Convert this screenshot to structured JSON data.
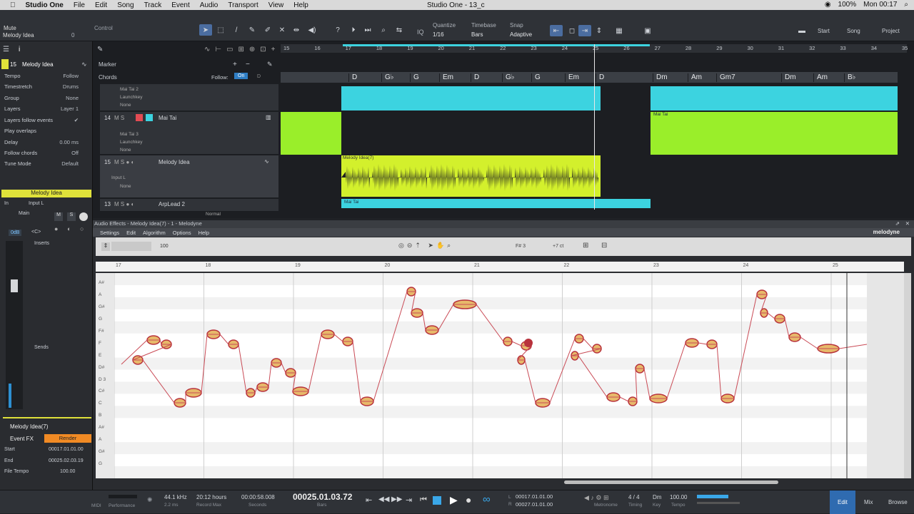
{
  "menubar": {
    "app": "Studio One",
    "items": [
      "File",
      "Edit",
      "Song",
      "Track",
      "Event",
      "Audio",
      "Transport",
      "View",
      "Help"
    ],
    "battery": "100%",
    "clock": "Mon 00:17"
  },
  "window": {
    "title": "Studio One - 13_c"
  },
  "toolbar": {
    "mute_label": "Mute",
    "track_name": "Melody Idea",
    "value": "0",
    "control": "Control",
    "quantize_label": "Quantize",
    "quantize_value": "1/16",
    "timebase_label": "Timebase",
    "timebase_value": "Bars",
    "snap_label": "Snap",
    "snap_value": "Adaptive",
    "start": "Start",
    "song": "Song",
    "project": "Project",
    "iq": "IQ"
  },
  "inspector": {
    "track_number": "15",
    "track_name": "Melody Idea",
    "rows": [
      {
        "k": "Tempo",
        "v": "Follow"
      },
      {
        "k": "Timestretch",
        "v": "Drums"
      },
      {
        "k": "Group",
        "v": "None"
      },
      {
        "k": "Layers",
        "v": "Layer 1"
      },
      {
        "k": "Layers follow events",
        "v": ""
      },
      {
        "k": "Play overlaps",
        "v": ""
      },
      {
        "k": "Delay",
        "v": "0.00 ms"
      },
      {
        "k": "Follow chords",
        "v": "Off"
      },
      {
        "k": "Tune Mode",
        "v": "Default"
      }
    ],
    "channel_name": "Melody Idea",
    "in_label": "In",
    "input": "Input L",
    "main": "Main",
    "db": "0dB",
    "pan": "<C>",
    "inserts": "Inserts",
    "sends": "Sends",
    "event_name": "Melody Idea(7)",
    "event_fx": "Event FX",
    "render": "Render",
    "start_label": "Start",
    "start": "00017.01.01.00",
    "end_label": "End",
    "end": "00025.02.03.19",
    "tempo_label": "File Tempo",
    "tempo": "100.00"
  },
  "arrange": {
    "marker": "Marker",
    "chords": "Chords",
    "follow": "Follow:",
    "on": "On",
    "ruler": [
      "15",
      "16",
      "17",
      "18",
      "19",
      "20",
      "21",
      "22",
      "23",
      "24",
      "25",
      "26",
      "27",
      "28",
      "29",
      "30",
      "31",
      "32",
      "33",
      "34",
      "35"
    ],
    "chordlist": [
      "D",
      "G♭",
      "G",
      "Em",
      "D",
      "G♭",
      "G",
      "Em",
      "D",
      "Dm",
      "Am",
      "Gm7",
      "Dm",
      "Am",
      "B♭"
    ],
    "tracks": [
      {
        "num": "",
        "name": "",
        "sub": [
          "Mai Tai 2",
          "Launchkey",
          "None"
        ]
      },
      {
        "num": "14",
        "name": "Mai Tai",
        "sub": [
          "Mai Tai 3",
          "Launchkey",
          "None"
        ]
      },
      {
        "num": "15",
        "name": "Melody Idea",
        "sub": [
          "Input L",
          "None"
        ]
      },
      {
        "num": "13",
        "name": "ArpLead 2",
        "sub": [
          "Normal"
        ]
      }
    ],
    "clip_labels": {
      "melody": "Melody Idea(7)",
      "maitai": "Mai Tai"
    }
  },
  "melodyne": {
    "title": "Audio Effects - Melody Idea(7) - 1 - Melodyne",
    "menu": [
      "Settings",
      "Edit",
      "Algorithm",
      "Options",
      "Help"
    ],
    "brand": "melodyne",
    "zoom": "100",
    "pitch": "F# 3",
    "cents": "+7 ct",
    "ruler": [
      "17",
      "18",
      "19",
      "20",
      "21",
      "22",
      "23",
      "24",
      "25"
    ],
    "keys": [
      "A#",
      "A",
      "G#",
      "G",
      "F#",
      "F",
      "E",
      "D#",
      "D 3",
      "C#",
      "C",
      "B",
      "A#",
      "A",
      "G#",
      "G"
    ]
  },
  "transport": {
    "midi": "MIDI",
    "performance": "Performance",
    "rate": "44.1 kHz",
    "latency": "2.2 ms",
    "hours": "20:12 hours",
    "record_max": "Record Max",
    "seconds": "00:00:58.008",
    "seconds_label": "Seconds",
    "bars": "00025.01.03.72",
    "bars_label": "Bars",
    "loop_l": "00017.01.01.00",
    "loop_r": "00027.01.01.00",
    "metronome": "Metronome",
    "timesig": "4 / 4",
    "timing": "Timing",
    "key": "Dm",
    "key_label": "Key",
    "tempo": "100.00",
    "tempo_label": "Tempo",
    "edit": "Edit",
    "mix": "Mix",
    "browse": "Browse"
  },
  "colors": {
    "accent": "#4b6da0",
    "cyan": "#3cd3e0",
    "lime": "#9aee2a",
    "yellow": "#e0e23a",
    "blob": "#b8323c"
  }
}
